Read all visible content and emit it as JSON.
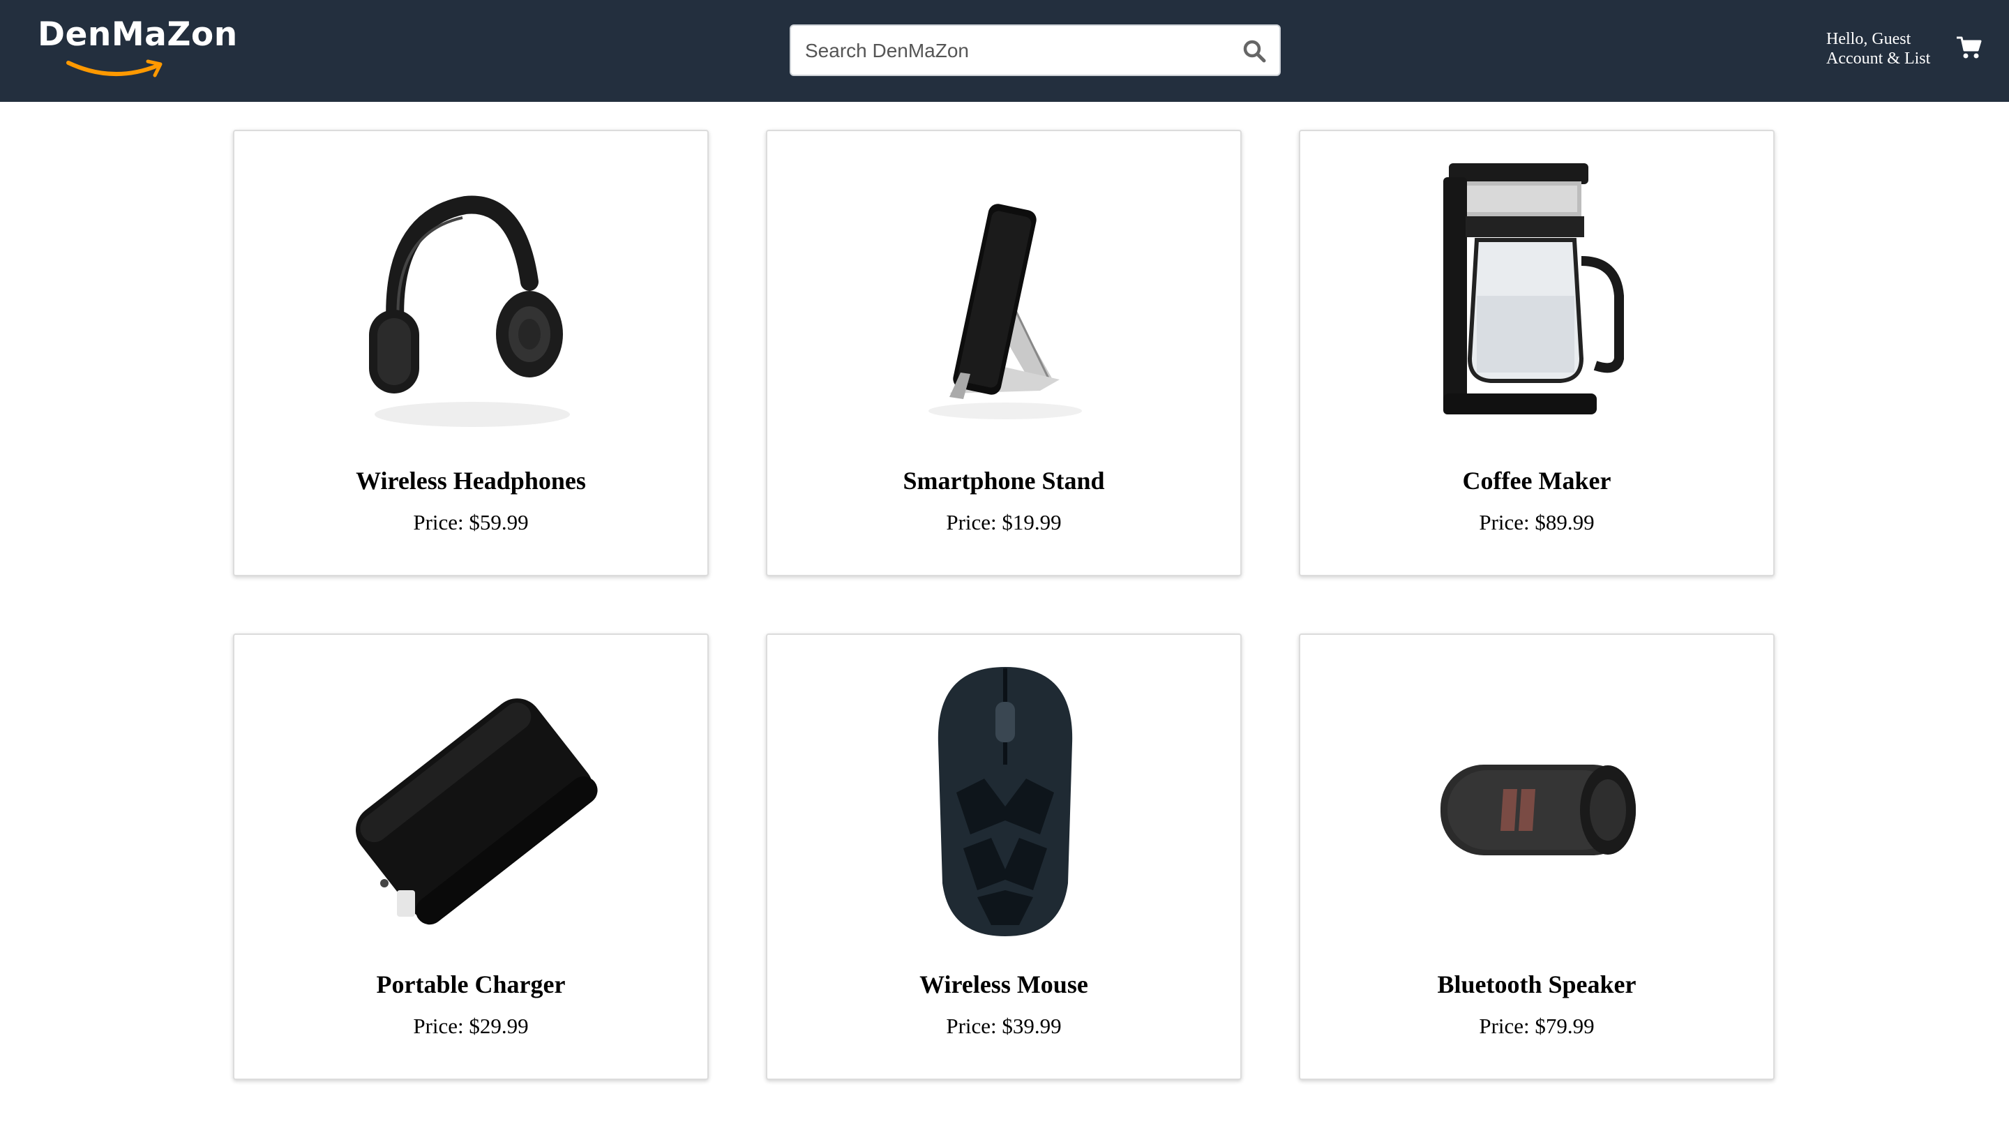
{
  "header": {
    "logo_text": "DenMaZon",
    "search_placeholder": "Search DenMaZon",
    "greeting": "Hello, Guest",
    "account_label": "Account & List",
    "brand_color": "#232f3e",
    "accent_color": "#ff9900"
  },
  "products": [
    {
      "name": "Wireless Headphones",
      "price_label": "Price:",
      "price": "$59.99",
      "image_icon": "headphones-icon"
    },
    {
      "name": "Smartphone Stand",
      "price_label": "Price:",
      "price": "$19.99",
      "image_icon": "phone-stand-icon"
    },
    {
      "name": "Coffee Maker",
      "price_label": "Price:",
      "price": "$89.99",
      "image_icon": "coffee-maker-icon"
    },
    {
      "name": "Portable Charger",
      "price_label": "Price:",
      "price": "$29.99",
      "image_icon": "power-bank-icon"
    },
    {
      "name": "Wireless Mouse",
      "price_label": "Price:",
      "price": "$39.99",
      "image_icon": "mouse-icon"
    },
    {
      "name": "Bluetooth Speaker",
      "price_label": "Price:",
      "price": "$79.99",
      "image_icon": "speaker-icon"
    }
  ]
}
